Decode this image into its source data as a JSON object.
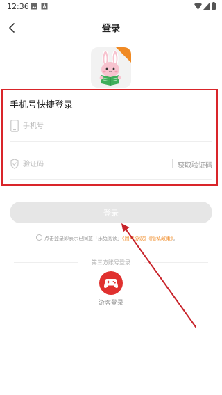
{
  "status_bar": {
    "time": "12:36"
  },
  "header": {
    "title": "登录"
  },
  "form": {
    "title": "手机号快捷登录",
    "phone_placeholder": "手机号",
    "code_placeholder": "验证码",
    "get_code_label": "获取验证码"
  },
  "login_button": {
    "label": "登录"
  },
  "agreement": {
    "prefix": "点击登录即表示已同意「乐兔阅读」",
    "user_agreement": "《用户协议》",
    "privacy_policy": "《隐私政策》",
    "suffix": "。"
  },
  "third_party": {
    "section_label": "第三方账号登录",
    "guest_label": "游客登录"
  },
  "colors": {
    "highlight_border": "#d9252a",
    "annotation_arrow": "#c8232a",
    "link_orange": "#f08a24",
    "guest_red": "#e0312f",
    "button_disabled": "#e6e6e6"
  }
}
